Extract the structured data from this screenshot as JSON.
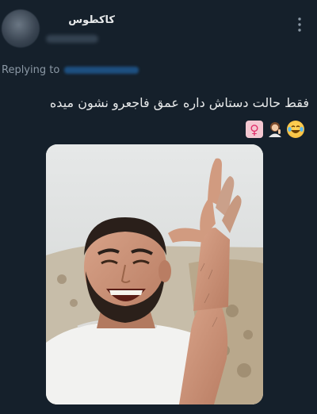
{
  "tweet": {
    "author_name": "کاکطوس",
    "replying_to_label": "Replying to",
    "text": "فقط حالت دستاش داره عمق فاجعرو نشون میده",
    "emojis": [
      "female-sign",
      "person-gesturing",
      "tears-of-joy"
    ]
  },
  "icons": {
    "more": "more-vertical-icon",
    "female": "female-sign-icon",
    "person": "person-gesturing-icon",
    "laugh": "tears-of-joy-icon"
  },
  "colors": {
    "background": "#15202b",
    "text_primary": "#e7e9ea",
    "text_secondary": "#8b98a5",
    "link_blurred": "#1d4f80"
  }
}
